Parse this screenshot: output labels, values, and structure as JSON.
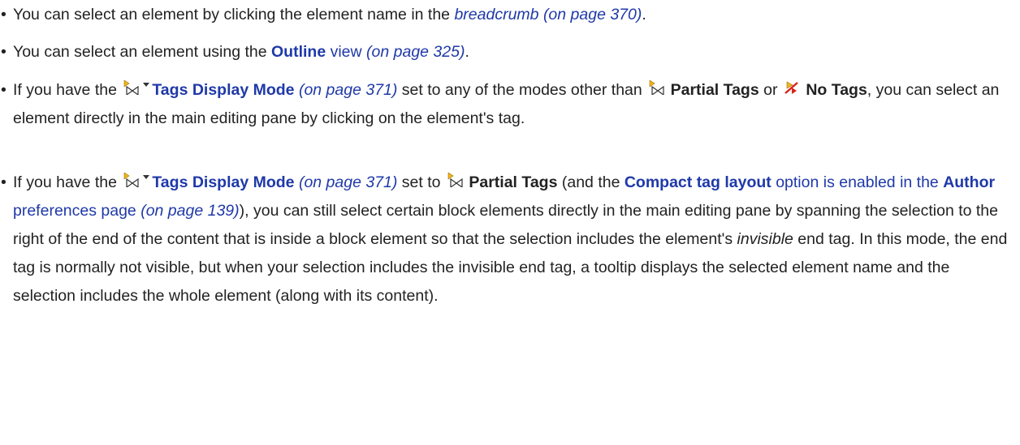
{
  "bullets": [
    {
      "p1": "You can select an element by clicking the element name in the ",
      "link": "breadcrumb",
      "ref": "(on page 370)",
      "end": "."
    },
    {
      "p1": "You can select an element using the ",
      "link_strong": "Outline",
      "link_rest": " view",
      "ref": "(on page 325)",
      "end": "."
    },
    {
      "p1": "If you have the ",
      "link_strong": "Tags Display Mode",
      "ref": "(on page 371)",
      "p2": " set to any of the modes other than ",
      "strong1": "Partial Tags",
      "p3": " or ",
      "strong2": "No Tags",
      "p4": ", you can select an element directly in the main editing pane by clicking on the element's tag."
    },
    {
      "p1": "If you have the ",
      "link_strong": "Tags Display Mode",
      "ref": "(on page 371)",
      "p2": " set to ",
      "strong1": "Partial Tags",
      "p3": " (and the ",
      "link2_strong": "Compact tag layout",
      "link2_rest": " option is enabled in the ",
      "link2_strong2": "Author",
      "link2_rest2": " preferences page",
      "ref2": "(on page 139)",
      "p4": "), you can still select certain block elements directly in the main editing pane by spanning the selection to the right of the end of the content that is inside a block element so that the selection includes the element's ",
      "em": "invisible",
      "p5": " end tag. In this mode, the end tag is normally not visible, but when your selection includes the invisible end tag, a tooltip displays the selected element name and the selection includes the whole element (along with its content)."
    }
  ],
  "icons": {
    "tags_mode": "tags-display-mode-icon",
    "dropdown": "dropdown-arrow-icon",
    "partial_tags": "partial-tags-icon",
    "no_tags": "no-tags-icon"
  },
  "colors": {
    "link": "#1f39a8",
    "text": "#222222",
    "icon_yellow": "#f2b51c",
    "icon_red": "#d8231c"
  }
}
